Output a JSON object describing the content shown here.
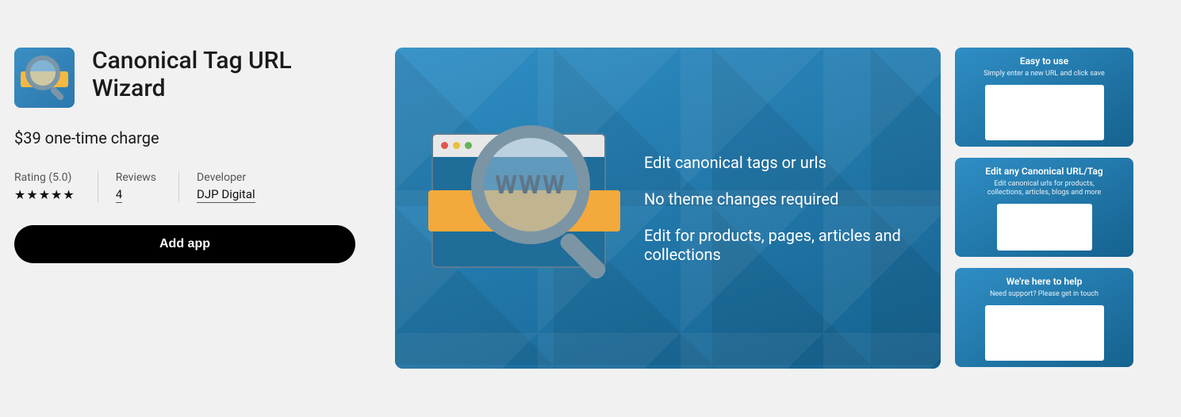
{
  "app": {
    "title": "Canonical Tag URL Wizard",
    "price": "$39 one-time charge"
  },
  "meta": {
    "rating_label": "Rating (5.0)",
    "rating_value": 5.0,
    "reviews_label": "Reviews",
    "reviews_count": "4",
    "developer_label": "Developer",
    "developer_name": "DJP Digital"
  },
  "cta": {
    "add_label": "Add app"
  },
  "hero": {
    "graphic_text": "WWW",
    "bullets": [
      "Edit canonical tags or urls",
      "No theme changes required",
      "Edit for products, pages, articles and collections"
    ]
  },
  "thumbs": [
    {
      "title": "Easy to use",
      "sub": "Simply enter a new URL and click save"
    },
    {
      "title": "Edit any Canonical URL/Tag",
      "sub": "Edit canonical urls for products, collections, articles, blogs and more"
    },
    {
      "title": "We're here to help",
      "sub": "Need support? Please get in touch"
    }
  ]
}
